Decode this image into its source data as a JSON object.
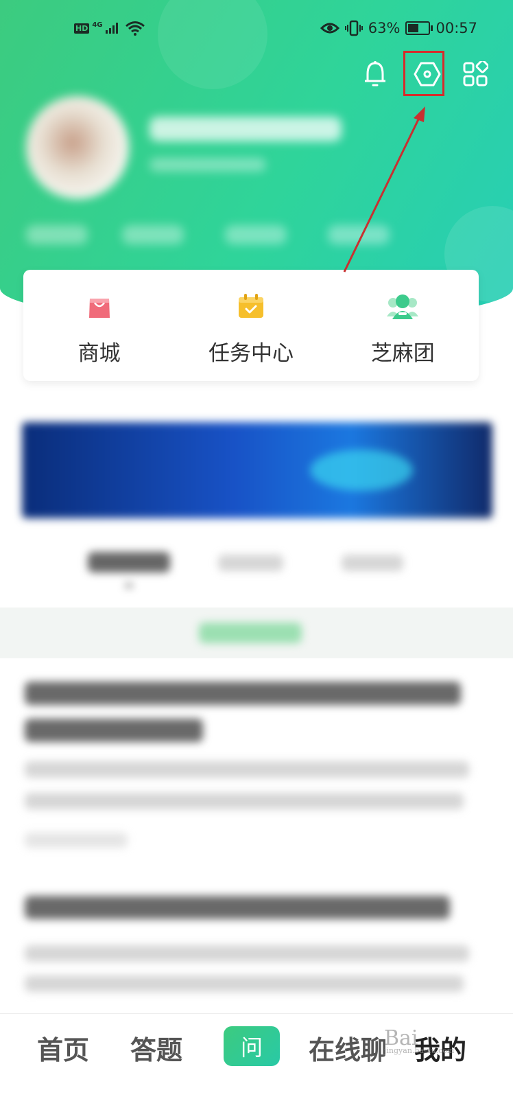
{
  "status_bar": {
    "hd": "HD",
    "network": "4G",
    "battery": "63%",
    "battery_level": 0.63,
    "time": "00:57"
  },
  "header": {
    "icons": [
      "bell-icon",
      "settings-hexagon-icon",
      "apps-grid-icon"
    ],
    "accent_gradient": [
      "#3ccb7f",
      "#27ceb6"
    ],
    "highlight_color": "#d62b2b"
  },
  "quick_actions": [
    {
      "label": "商城",
      "icon": "shopping-bag-icon",
      "color": "#f06b7a"
    },
    {
      "label": "任务中心",
      "icon": "calendar-check-icon",
      "color": "#f6bf2c"
    },
    {
      "label": "芝麻团",
      "icon": "group-icon",
      "color": "#3ccb8c"
    }
  ],
  "bottom_nav": {
    "home": "首页",
    "answer": "答题",
    "ask": "问",
    "chat": "在线聊",
    "mine": "我的"
  }
}
